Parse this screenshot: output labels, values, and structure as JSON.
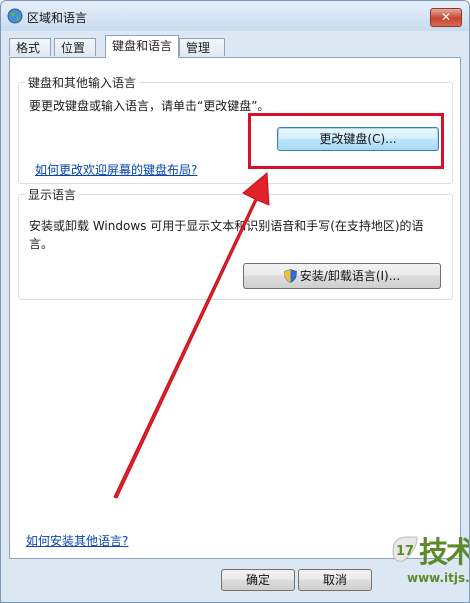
{
  "window": {
    "title": "区域和语言",
    "close_label": "✕"
  },
  "tabs": [
    {
      "label": "格式"
    },
    {
      "label": "位置"
    },
    {
      "label": "键盘和语言"
    },
    {
      "label": "管理"
    }
  ],
  "keyboard_group": {
    "title": "键盘和其他输入语言",
    "description": "要更改键盘或输入语言，请单击“更改键盘”。",
    "change_keyboard_button": "更改键盘(C)...",
    "welcome_layout_link": "如何更改欢迎屏幕的键盘布局?"
  },
  "display_group": {
    "title": "显示语言",
    "description_line1": "安装或卸载 Windows 可用于显示文本和识别语音和手写(在支持地区)的语",
    "description_line2": "言。",
    "install_button": "安装/卸载语言(I)..."
  },
  "install_other_link": "如何安装其他语言?",
  "footer": {
    "ok_button": "确定",
    "cancel_button": "取消"
  },
  "watermark": {
    "brand": "技术网",
    "logo_number": "17",
    "url": "www.itjs.cn"
  },
  "colors": {
    "annotation": "#d8102b",
    "link": "#0645ad",
    "watermark": "#5f8a2c"
  }
}
